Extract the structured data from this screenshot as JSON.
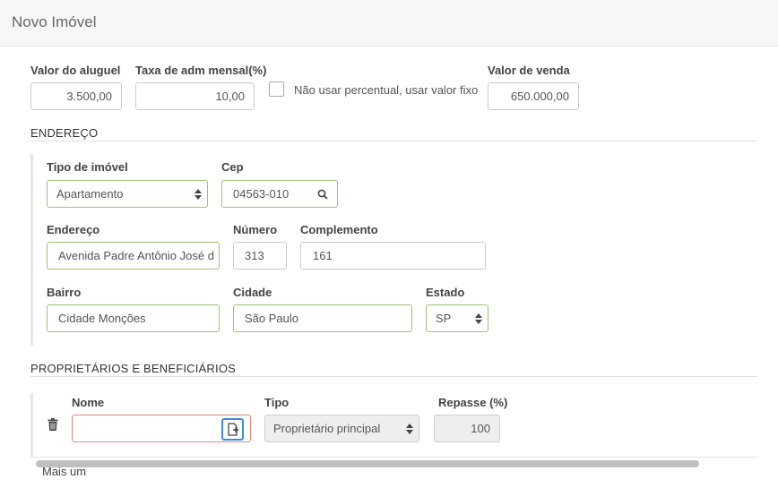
{
  "header": {
    "title": "Novo Imóvel"
  },
  "values": {
    "rent_label": "Valor do aluguel",
    "rent_value": "3.500,00",
    "fee_label": "Taxa de adm mensal(%)",
    "fee_value": "10,00",
    "fixed_checkbox_label": "Não usar percentual, usar valor fixo",
    "sale_label": "Valor de venda",
    "sale_value": "650.000,00"
  },
  "address": {
    "section_title": "ENDEREÇO",
    "type_label": "Tipo de imóvel",
    "type_value": "Apartamento",
    "cep_label": "Cep",
    "cep_value": "04563-010",
    "street_label": "Endereço",
    "street_value": "Avenida Padre Antônio José d",
    "number_label": "Número",
    "number_value": "313",
    "complement_label": "Complemento",
    "complement_value": "161",
    "district_label": "Bairro",
    "district_value": "Cidade Monções",
    "city_label": "Cidade",
    "city_value": "São Paulo",
    "state_label": "Estado",
    "state_value": "SP"
  },
  "owners": {
    "section_title": "PROPRIETÁRIOS E BENEFICIÁRIOS",
    "columns": {
      "name": "Nome",
      "type": "Tipo",
      "share": "Repasse (%)"
    },
    "rows": [
      {
        "name": "",
        "type": "Proprietário principal",
        "share": "100"
      }
    ],
    "more_link": "Mais um"
  },
  "icons": [
    "search-icon",
    "add-person-icon",
    "trash-icon",
    "chevron-updown-icon"
  ],
  "colors": {
    "valid_border": "#9bc472",
    "error_border": "#e08a78",
    "focus_blue": "#3d8be0"
  }
}
